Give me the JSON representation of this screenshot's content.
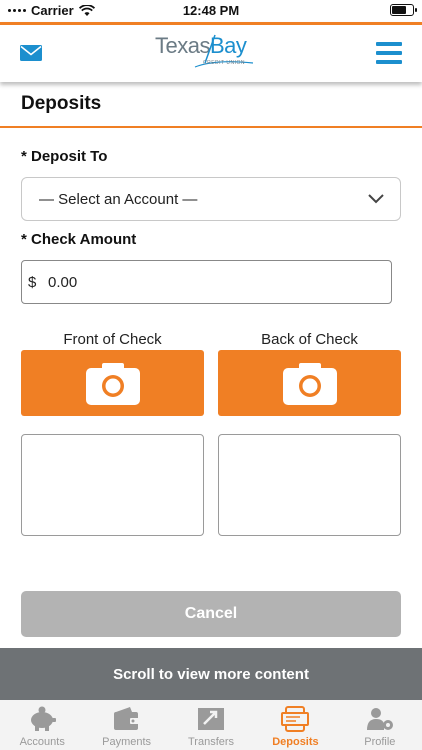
{
  "status_bar": {
    "carrier": "Carrier",
    "time": "12:48 PM"
  },
  "header": {
    "logo_text_left": "Texas",
    "logo_text_right": "Bay",
    "logo_subtext": "CREDIT UNION",
    "colors": {
      "accent": "#f07f24",
      "brand_blue": "#1c8fce"
    }
  },
  "page": {
    "title": "Deposits"
  },
  "form": {
    "deposit_to_label": "* Deposit To",
    "account_select_value": "— Select an Account —",
    "check_amount_label": "* Check Amount",
    "currency_symbol": "$",
    "amount_value": "0.00",
    "front_label": "Front of Check",
    "back_label": "Back of Check",
    "cancel_label": "Cancel"
  },
  "scroll_banner": "Scroll to view more content",
  "tabbar": {
    "active": "Deposits",
    "items": [
      {
        "label": "Accounts",
        "icon": "piggy-bank-icon"
      },
      {
        "label": "Payments",
        "icon": "wallet-icon"
      },
      {
        "label": "Transfers",
        "icon": "transfer-arrows-icon"
      },
      {
        "label": "Deposits",
        "icon": "mobile-check-icon"
      },
      {
        "label": "Profile",
        "icon": "profile-gear-icon"
      }
    ]
  }
}
